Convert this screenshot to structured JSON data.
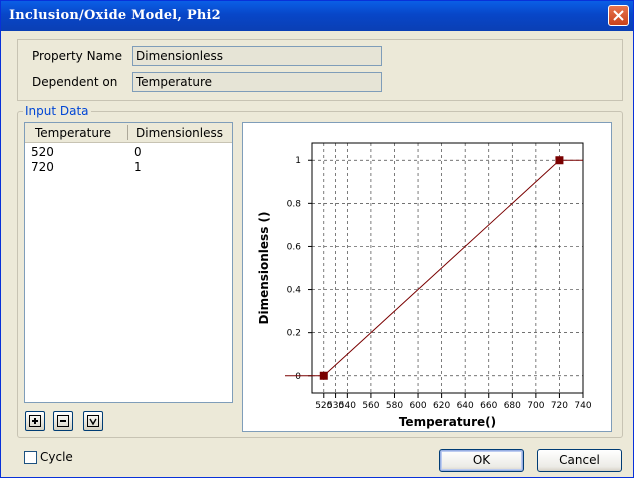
{
  "window": {
    "title": "Inclusion/Oxide Model, Phi2"
  },
  "properties": {
    "property_name_label": "Property Name",
    "property_name_value": "Dimensionless",
    "dependent_on_label": "Dependent on",
    "dependent_on_value": "Temperature"
  },
  "input_data": {
    "label": "Input Data",
    "columns": [
      "Temperature",
      "Dimensionless"
    ],
    "rows": [
      [
        "520",
        "0"
      ],
      [
        "720",
        "1"
      ]
    ]
  },
  "toolbar": {
    "add_icon": "plus-icon",
    "remove_icon": "minus-icon",
    "more_icon": "chevron-down-icon"
  },
  "cycle": {
    "label": "Cycle",
    "checked": false
  },
  "buttons": {
    "ok_label": "OK",
    "cancel_label": "Cancel"
  },
  "colors": {
    "series": "#7a0000",
    "accent": "#0046d5"
  },
  "chart_data": {
    "type": "line",
    "x": [
      520,
      720
    ],
    "y": [
      0,
      1
    ],
    "xlabel": "Temperature()",
    "ylabel": "Dimensionless ()",
    "xlim": [
      510,
      740
    ],
    "ylim": [
      -0.08,
      1.08
    ],
    "xticks": [
      520,
      530,
      540,
      560,
      580,
      600,
      620,
      640,
      660,
      680,
      700,
      720,
      740
    ],
    "yticks": [
      0,
      0.2,
      0.4,
      0.6,
      0.8,
      1
    ],
    "ytick_labels": [
      "0",
      "0.2",
      "0.4",
      "0.6",
      "0.8",
      "1"
    ],
    "grid": true,
    "extend_flat": true
  }
}
